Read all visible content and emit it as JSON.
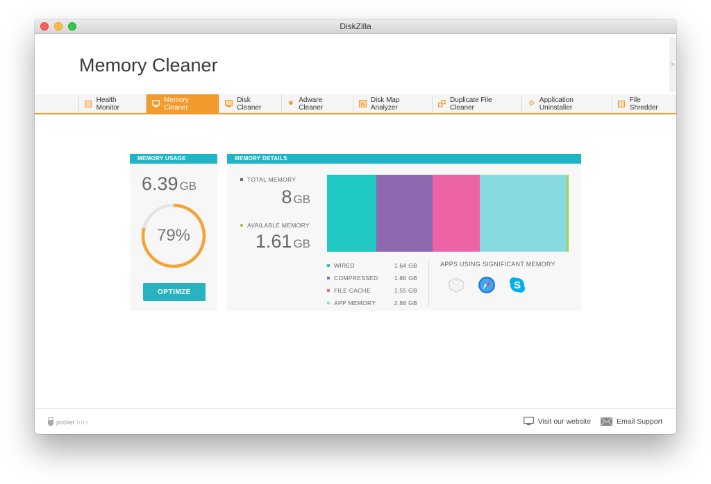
{
  "window": {
    "title": "DiskZilla"
  },
  "header": {
    "title": "Memory Cleaner",
    "side_arrow": ">"
  },
  "tabs": [
    {
      "label": "Health Monitor",
      "icon": "health-monitor-icon",
      "active": false
    },
    {
      "label": "Memory Cleaner",
      "icon": "monitor-icon",
      "active": true
    },
    {
      "label": "Disk Cleaner",
      "icon": "disk-cleaner-icon",
      "active": false
    },
    {
      "label": "Adware Cleaner",
      "icon": "bug-icon",
      "active": false
    },
    {
      "label": "Disk Map Analyzer",
      "icon": "chart-icon",
      "active": false
    },
    {
      "label": "Duplicate File Cleaner",
      "icon": "duplicate-icon",
      "active": false
    },
    {
      "label": "Application Uninstaller",
      "icon": "gear-icon",
      "active": false
    },
    {
      "label": "File Shredder",
      "icon": "shredder-icon",
      "active": false
    }
  ],
  "usage": {
    "heading": "MEMORY USAGE",
    "value": "6.39",
    "unit": "GB",
    "percent_label": "79%",
    "percent": 79,
    "button": "OPTIMZE"
  },
  "details": {
    "heading": "MEMORY DETAILS",
    "total_label": "TOTAL MEMORY",
    "total_value": "8",
    "total_unit": "GB",
    "available_label": "AVAILABLE MEMORY",
    "available_value": "1.61",
    "available_unit": "GB",
    "segments": [
      {
        "name": "WIRED",
        "value_label": "1.64 GB",
        "gb": 1.64,
        "color": "#1fc8c0"
      },
      {
        "name": "COMPRESSED",
        "value_label": "1.86 GB",
        "gb": 1.86,
        "color": "#8e69b0"
      },
      {
        "name": "FILE CACHE",
        "value_label": "1.55 GB",
        "gb": 1.55,
        "color": "#ec64a4"
      },
      {
        "name": "APP MEMORY",
        "value_label": "2.88 GB",
        "gb": 2.88,
        "color": "#87dae0"
      }
    ],
    "free_color": "#a4cf55",
    "apps_title": "APPS USING SIGNIFICANT MEMORY",
    "apps": [
      "generic-app-icon",
      "safari-icon",
      "skype-icon"
    ]
  },
  "colors": {
    "accent": "#f39a2c",
    "teal": "#1eb5c6"
  },
  "footer": {
    "brand_a": "pocket",
    "brand_b": "bits",
    "website": "Visit our website",
    "support": "Email Support"
  }
}
